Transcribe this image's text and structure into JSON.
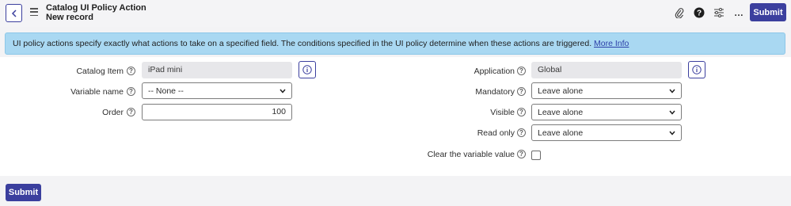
{
  "header": {
    "title": "Catalog UI Policy Action",
    "subtitle": "New record",
    "submit_label": "Submit",
    "more_label": "…"
  },
  "banner": {
    "text": "UI policy actions specify exactly what actions to take on a specified field. The conditions specified in the UI policy determine when these actions are triggered.",
    "link_label": "More Info"
  },
  "form": {
    "catalog_item": {
      "label": "Catalog Item",
      "value": "iPad mini"
    },
    "variable_name": {
      "label": "Variable name",
      "value": "-- None --"
    },
    "order": {
      "label": "Order",
      "value": "100"
    },
    "application": {
      "label": "Application",
      "value": "Global"
    },
    "mandatory": {
      "label": "Mandatory",
      "value": "Leave alone"
    },
    "visible": {
      "label": "Visible",
      "value": "Leave alone"
    },
    "read_only": {
      "label": "Read only",
      "value": "Leave alone"
    },
    "clear_value": {
      "label": "Clear the variable value",
      "checked": false
    },
    "help_glyph": "?"
  },
  "footer": {
    "submit_label": "Submit"
  },
  "colors": {
    "brand": "#3b3f9e",
    "banner_bg": "#a9d8f2",
    "readonly_bg": "#e7e7ea"
  }
}
